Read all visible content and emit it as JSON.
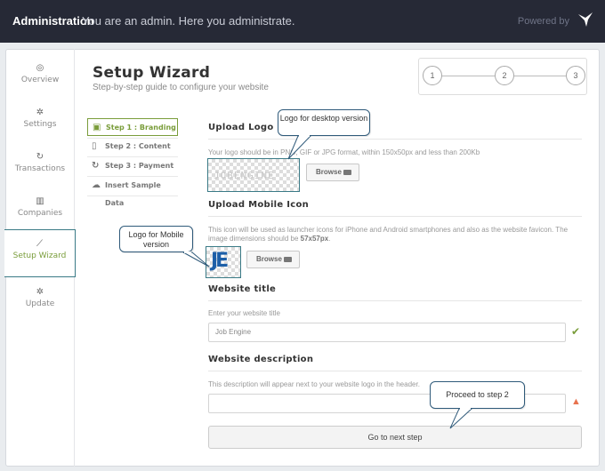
{
  "topbar": {
    "brand": "Administration",
    "tagline": "You are an admin. Here you administrate.",
    "powered": "Powered by"
  },
  "sidebar": {
    "items": [
      {
        "label": "Overview",
        "icon": "dashboard-icon"
      },
      {
        "label": "Settings",
        "icon": "gear-icon"
      },
      {
        "label": "Transactions",
        "icon": "refresh-icon"
      },
      {
        "label": "Companies",
        "icon": "building-icon"
      },
      {
        "label": "Setup Wizard",
        "icon": "wand-icon",
        "active": true
      },
      {
        "label": "Update",
        "icon": "gear-icon"
      }
    ]
  },
  "header": {
    "title": "Setup Wizard",
    "subtitle": "Step-by-step guide to configure your website"
  },
  "progress": {
    "steps": [
      "1",
      "2",
      "3"
    ]
  },
  "wizard": {
    "steps": [
      {
        "label": "Step 1 : Branding",
        "active": true
      },
      {
        "label": "Step 2 : Content"
      },
      {
        "label": "Step 3 : Payment"
      },
      {
        "label": "Insert Sample Data"
      }
    ]
  },
  "branding": {
    "upload_logo_heading": "Upload Logo",
    "upload_logo_help": "Your logo should be in PNG, GIF or JPG format, within 150x50px and less than 200Kb",
    "logo_text": "JOBENGINE",
    "browse_label": "Browse",
    "upload_mobile_heading": "Upload Mobile Icon",
    "upload_mobile_help_1": "This icon will be used as launcher icons for iPhone and Android smartphones and also as the website favicon. The image dimensions should be ",
    "upload_mobile_help_bold": "57x57px",
    "upload_mobile_help_2": ".",
    "mobile_logo_text": "JE",
    "website_title_heading": "Website title",
    "website_title_help": "Enter your website title",
    "website_title_value": "Job Engine",
    "website_desc_heading": "Website description",
    "website_desc_help": "This description will appear next to your website logo in the header.",
    "website_desc_value": "",
    "next_button": "Go to next step"
  },
  "callouts": {
    "desktop": "Logo for desktop version",
    "mobile": "Logo for Mobile version",
    "proceed": "Proceed to step 2"
  },
  "colors": {
    "topbar_bg": "#262936",
    "active_green": "#7a9d3b",
    "annotation_border": "#3a7a86",
    "warning": "#e8734f"
  }
}
